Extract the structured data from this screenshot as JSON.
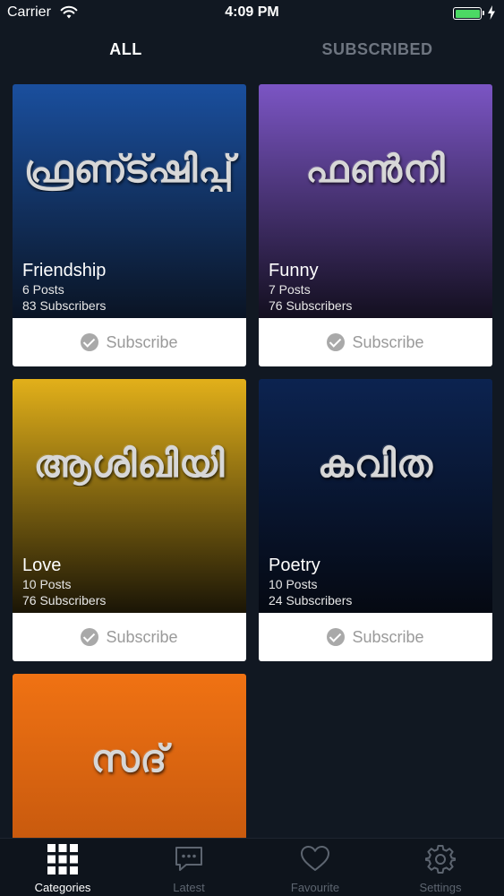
{
  "status_bar": {
    "carrier": "Carrier",
    "time": "4:09 PM",
    "battery_fraction": 1.0
  },
  "top_tabs": {
    "all": "ALL",
    "subscribed": "SUBSCRIBED"
  },
  "categories": [
    {
      "script": "ഫ്രണ്ട്ഷിപ്പ്",
      "title": "Friendship",
      "posts": "6 Posts",
      "subscribers": "83 Subscribers",
      "button": "Subscribe",
      "gradient_top": "#1a4f9e",
      "gradient_bottom": "#0a1424"
    },
    {
      "script": "ഫൺനി",
      "title": "Funny",
      "posts": "7 Posts",
      "subscribers": "76 Subscribers",
      "button": "Subscribe",
      "gradient_top": "#7b55c4",
      "gradient_bottom": "#130f1f"
    },
    {
      "script": "ആശിഖിയി",
      "title": "Love",
      "posts": "10 Posts",
      "subscribers": "76 Subscribers",
      "button": "Subscribe",
      "gradient_top": "#e2b01a",
      "gradient_bottom": "#1a1506"
    },
    {
      "script": "കവിത",
      "title": "Poetry",
      "posts": "10 Posts",
      "subscribers": "24 Subscribers",
      "button": "Subscribe",
      "gradient_top": "#0c2350",
      "gradient_bottom": "#050912"
    },
    {
      "script": "സദ്",
      "title": "",
      "posts": "",
      "subscribers": "",
      "button": "",
      "gradient_top": "#f07213",
      "gradient_bottom": "#b8500c"
    }
  ],
  "tab_bar": {
    "items": [
      {
        "label": "Categories",
        "icon": "grid-icon",
        "active": true
      },
      {
        "label": "Latest",
        "icon": "chat-bubble-icon",
        "active": false
      },
      {
        "label": "Favourite",
        "icon": "heart-icon",
        "active": false
      },
      {
        "label": "Settings",
        "icon": "gear-icon",
        "active": false
      }
    ]
  },
  "colors": {
    "background": "#111822",
    "active_tab": "#ffffff",
    "inactive_tab": "#6e7580",
    "battery": "#4cd964"
  }
}
